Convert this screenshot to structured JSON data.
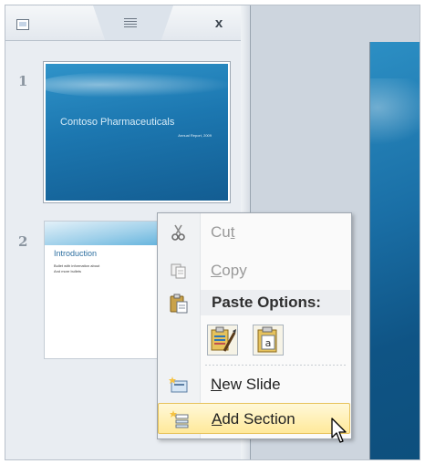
{
  "panel": {
    "slides_tab_icon": "slides-tab-icon",
    "outline_tab_icon": "outline-list-icon",
    "close_label": "x",
    "slides": [
      {
        "number": "1",
        "title": "Contoso Pharmaceuticals",
        "subtitle": "Annual Report, 2009"
      },
      {
        "number": "2",
        "heading": "Introduction",
        "bullet_1": "Bullet with information about",
        "bullet_2": "And more bullets"
      }
    ]
  },
  "context_menu": {
    "cut": {
      "label_pre": "Cu",
      "label_u": "t",
      "label_post": "",
      "icon": "scissors-icon",
      "enabled": false
    },
    "copy": {
      "label_pre": "",
      "label_u": "C",
      "label_post": "opy",
      "icon": "copy-icon",
      "enabled": false
    },
    "paste_options": {
      "label": "Paste Options:",
      "icon": "paste-clipboard-icon"
    },
    "paste_buttons": [
      {
        "icon": "paste-use-destination-theme-icon"
      },
      {
        "icon": "paste-keep-text-only-icon"
      }
    ],
    "new_slide": {
      "label_pre": "",
      "label_u": "N",
      "label_post": "ew Slide",
      "icon": "new-slide-icon"
    },
    "add_section": {
      "label_pre": "",
      "label_u": "A",
      "label_post": "dd Section",
      "icon": "add-section-icon",
      "highlighted": true
    }
  },
  "colors": {
    "accent": "#1c77b0",
    "hover": "#ffe99a"
  }
}
